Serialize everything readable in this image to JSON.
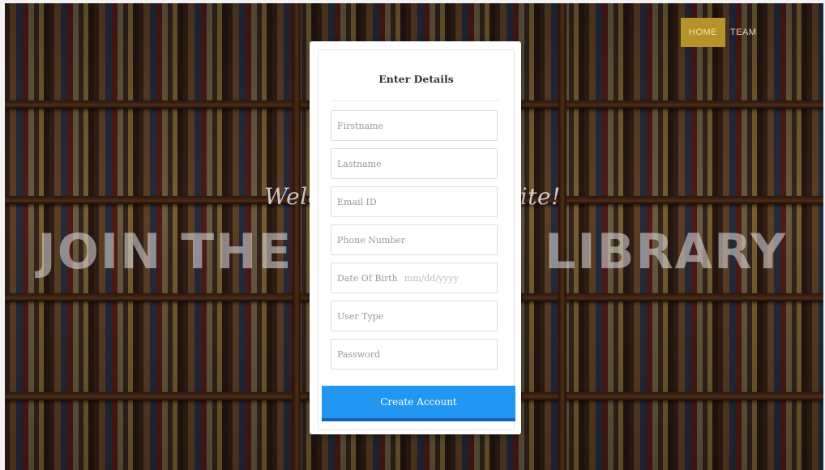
{
  "nav": {
    "home_label": "HOME",
    "team_label": "TEAM"
  },
  "hero": {
    "welcome_text": "Welcome to our Website!",
    "headline": "JOIN THE ONLINE LIBRARY"
  },
  "form": {
    "title": "Enter Details",
    "fields": {
      "firstname": "Firstname",
      "lastname": "Lastname",
      "email": "Email ID",
      "phone": "Phone Number",
      "dob_label": "Date Of Birth",
      "dob_placeholder": "mm/dd/yyyy",
      "user_type": "User Type",
      "password": "Password"
    },
    "submit_label": "Create Account"
  },
  "colors": {
    "accent_button": "#2196f3",
    "nav_home_bg": "#b6932a"
  }
}
